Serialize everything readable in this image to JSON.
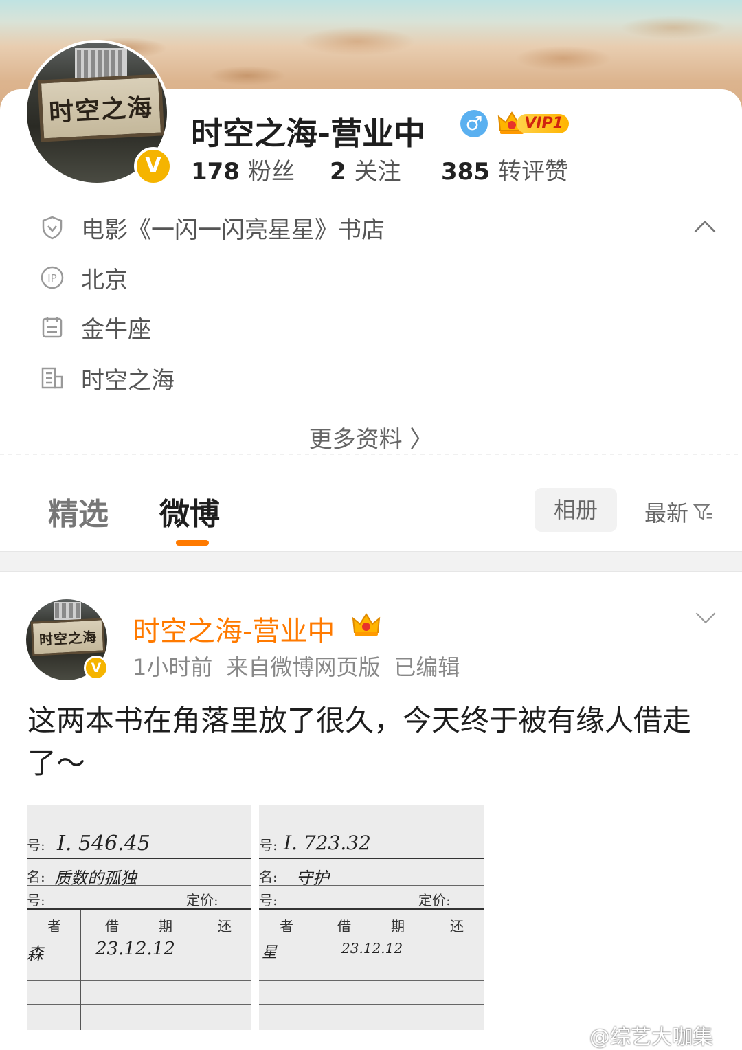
{
  "profile": {
    "name": "时空之海-营业中",
    "avatar_sign": "时空之海",
    "verify_badge": "V",
    "gender": "♂",
    "vip_label": "VIP1",
    "stats": {
      "fans_count": "178",
      "fans_label": "粉丝",
      "following_count": "2",
      "following_label": "关注",
      "interactions_count": "385",
      "interactions_label": "转评赞"
    },
    "info": {
      "certification": "电影《一闪一闪亮星星》书店",
      "ip_location": "北京",
      "constellation": "金牛座",
      "company": "时空之海"
    },
    "more_info": "更多资料 〉"
  },
  "tabs": {
    "featured": "精选",
    "weibo": "微博",
    "album": "相册",
    "sort": "最新"
  },
  "post": {
    "author": "时空之海-营业中",
    "time": "1小时前",
    "source": "来自微博网页版",
    "edited": "已编辑",
    "text": "这两本书在角落里放了很久，今天终于被有缘人借走了～",
    "images": [
      {
        "call_label": "号:",
        "call_number": "I. 546.45",
        "title_label": "名:",
        "title": "质数的孤独",
        "isbn_label": "号:",
        "price_label": "定价:",
        "col_reader": "者",
        "col_borrow": "借",
        "col_date": "期",
        "col_return": "还",
        "reader": "森",
        "date": "23.12.12"
      },
      {
        "call_label": "号:",
        "call_number": "I. 723.32",
        "title_label": "名:",
        "title": "守护",
        "isbn_label": "号:",
        "price_label": "定价:",
        "col_reader": "者",
        "col_borrow": "借",
        "col_date": "期",
        "col_return": "还",
        "reader": "星",
        "date": "23.12.12"
      }
    ]
  },
  "watermark": "@综艺大咖集",
  "colors": {
    "accent_orange": "#ff7a00",
    "verify_gold": "#f5b400",
    "gender_blue": "#5ab0f0"
  }
}
